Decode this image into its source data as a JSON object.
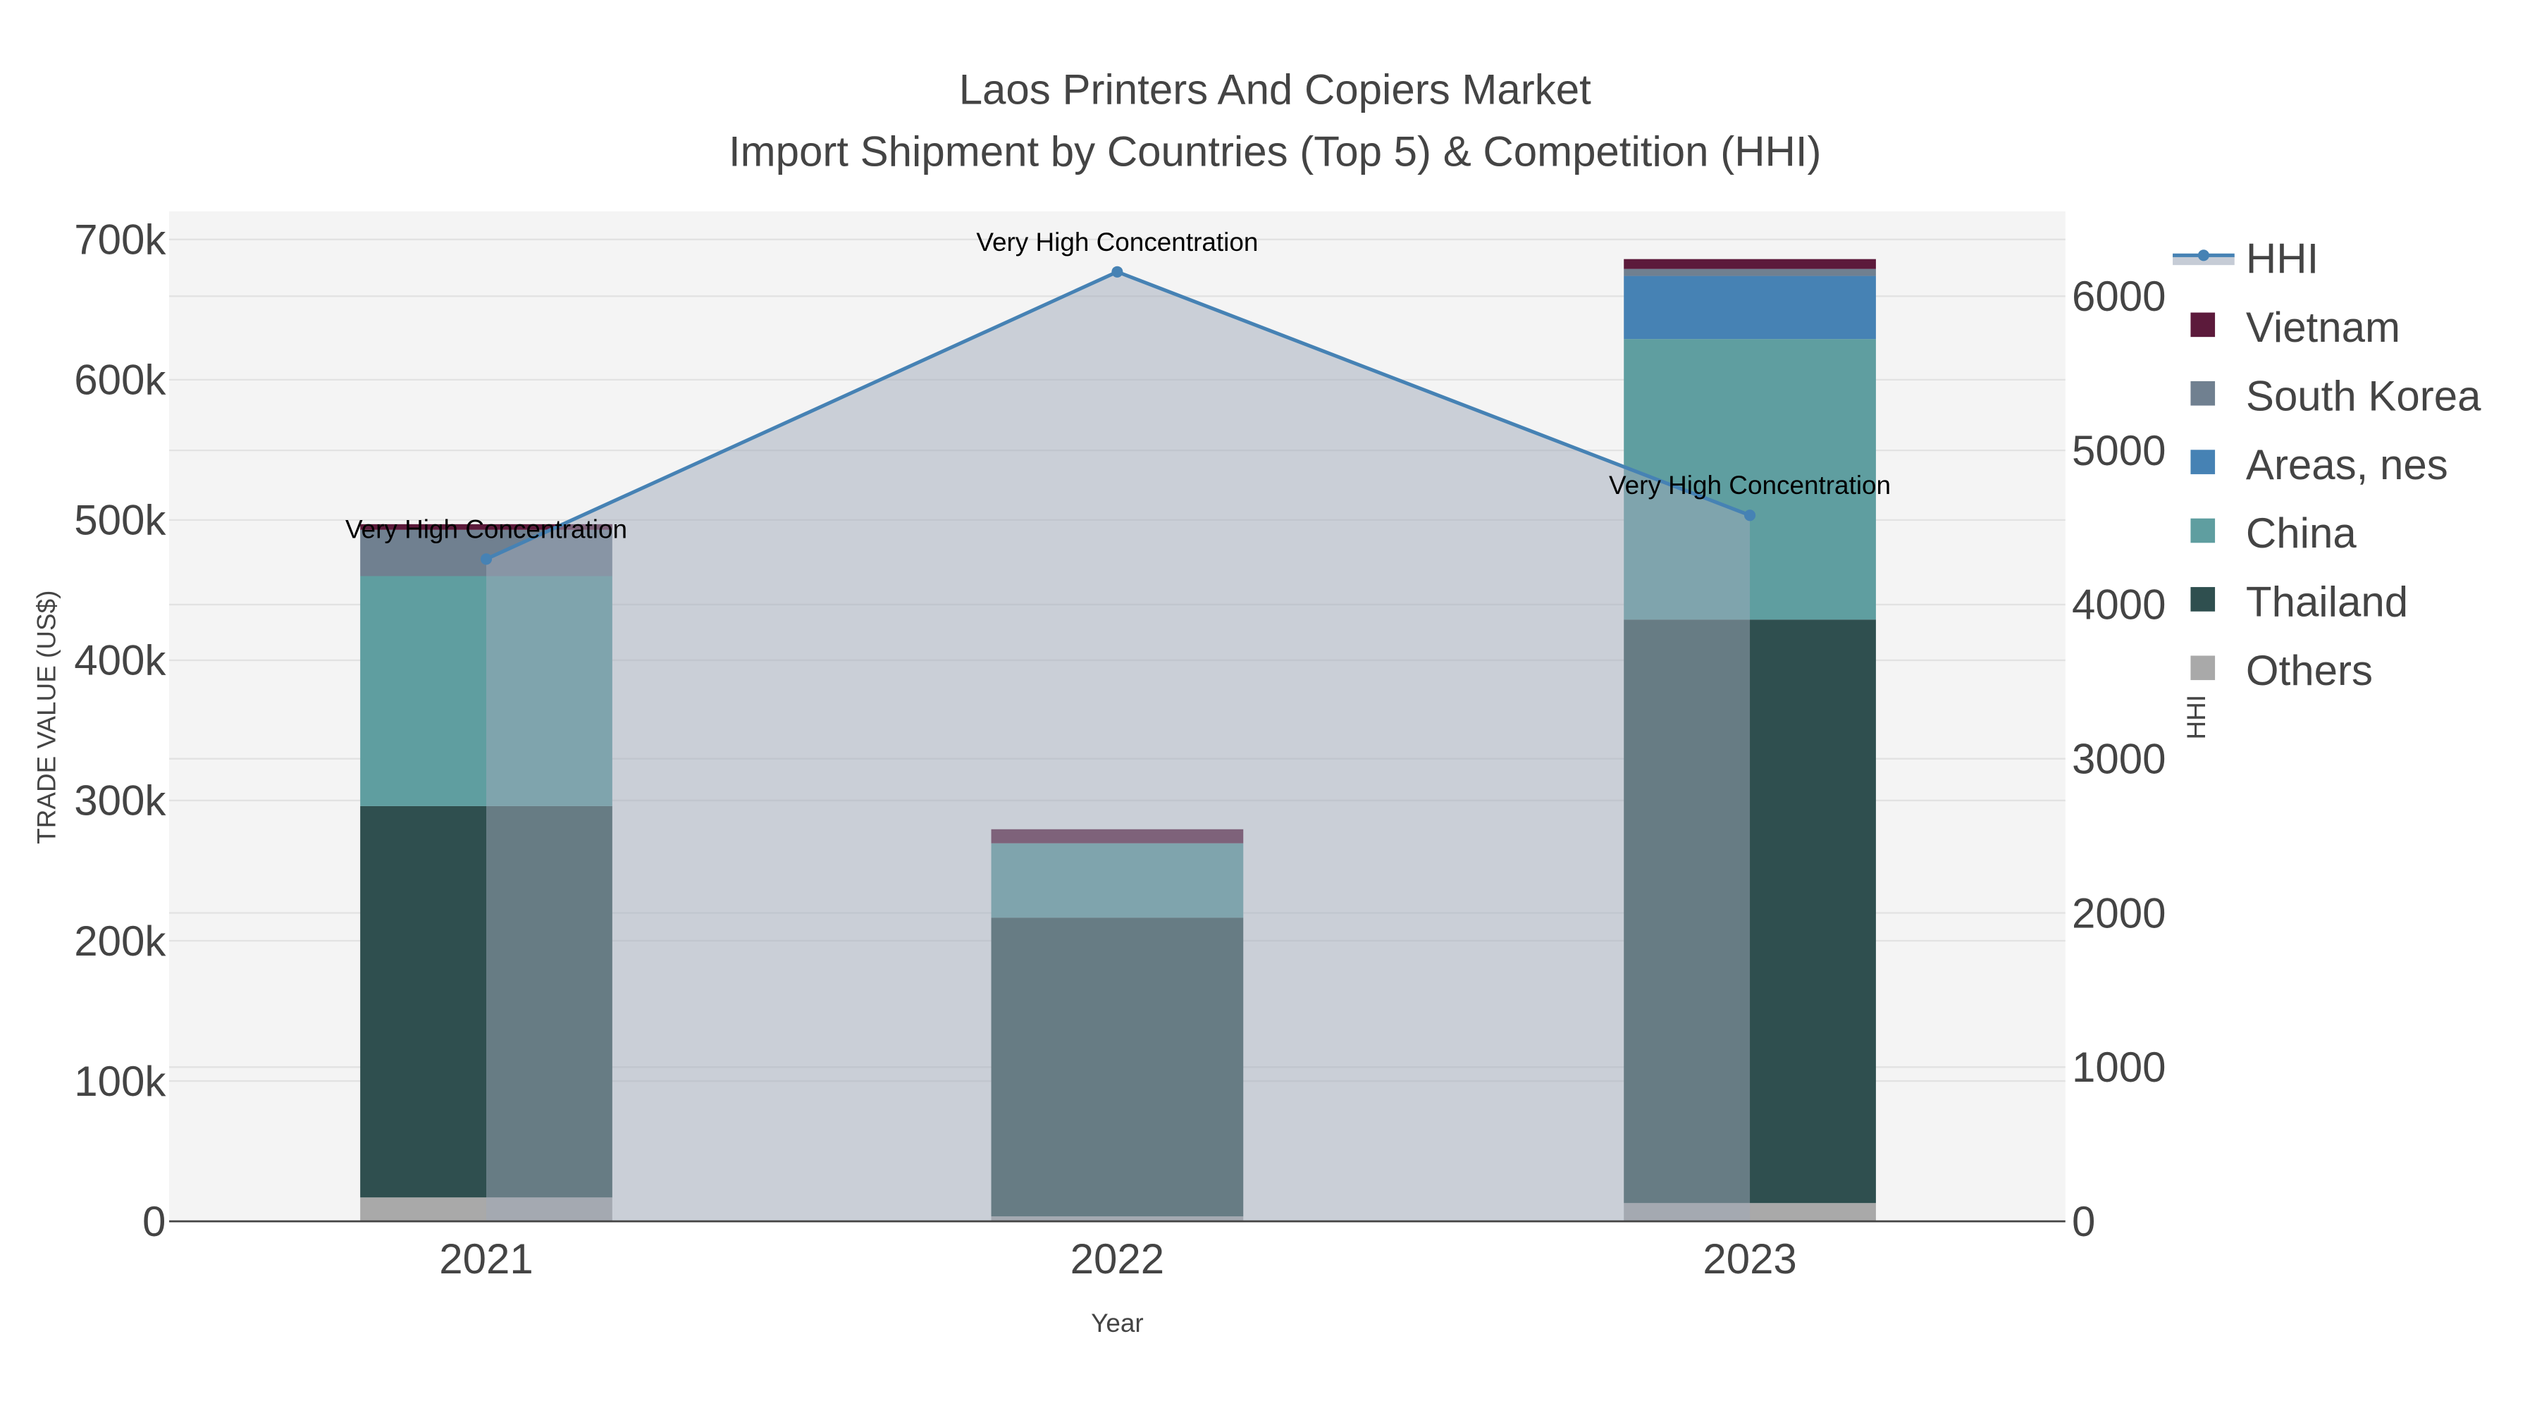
{
  "chart_data": {
    "type": "bar",
    "title": "Laos Printers And Copiers Market",
    "subtitle": "Import Shipment by Countries (Top 5) & Competition (HHI)",
    "xlabel": "Year",
    "ylabel": "TRADE VALUE (US$)",
    "y2label": "HHI",
    "categories": [
      "2021",
      "2022",
      "2023"
    ],
    "ylim": [
      0,
      720000
    ],
    "y2lim": [
      0,
      6550
    ],
    "yticks": [
      0,
      100000,
      200000,
      300000,
      400000,
      500000,
      600000,
      700000
    ],
    "ytick_labels": [
      "0",
      "100k",
      "200k",
      "300k",
      "400k",
      "500k",
      "600k",
      "700k"
    ],
    "y2ticks": [
      0,
      1000,
      2000,
      3000,
      4000,
      5000,
      6000
    ],
    "y2tick_labels": [
      "0",
      "1000",
      "2000",
      "3000",
      "4000",
      "5000",
      "6000"
    ],
    "stacked": true,
    "grid": true,
    "legend_position": "right",
    "series": [
      {
        "name": "Others",
        "color": "#a9a9a9",
        "values": [
          17000,
          3500,
          13000
        ]
      },
      {
        "name": "Thailand",
        "color": "#2f4f4f",
        "values": [
          279000,
          213000,
          416000
        ]
      },
      {
        "name": "China",
        "color": "#5f9ea0",
        "values": [
          164000,
          53000,
          200000
        ]
      },
      {
        "name": "Areas, nes",
        "color": "#4682b4",
        "values": [
          0,
          0,
          45000
        ]
      },
      {
        "name": "South Korea",
        "color": "#708090",
        "values": [
          33000,
          0,
          5000
        ]
      },
      {
        "name": "Vietnam",
        "color": "#5c1a3b",
        "values": [
          4000,
          10000,
          7000
        ]
      }
    ],
    "line": {
      "name": "HHI",
      "color": "#4682b4",
      "axis": "right",
      "values": [
        4295,
        6158,
        4579
      ],
      "annotations": [
        "Very High Concentration",
        "Very High Concentration",
        "Very High Concentration"
      ]
    },
    "legend_order": [
      "HHI",
      "Vietnam",
      "South Korea",
      "Areas, nes",
      "China",
      "Thailand",
      "Others"
    ]
  }
}
